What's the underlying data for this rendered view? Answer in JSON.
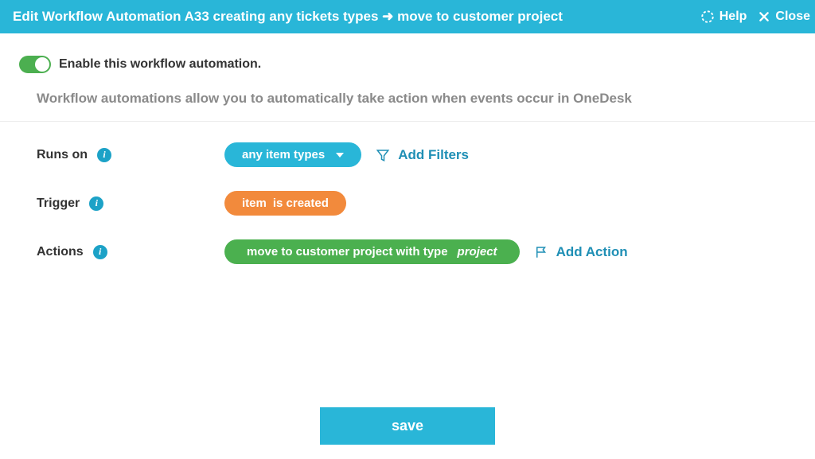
{
  "header": {
    "title": "Edit Workflow Automation A33 creating any tickets types ➜ move to customer project",
    "help": "Help",
    "close": "Close"
  },
  "enable": {
    "label": "Enable this workflow automation."
  },
  "description": "Workflow automations allow you to automatically take action when events occur in OneDesk",
  "labels": {
    "runs_on": "Runs on",
    "trigger": "Trigger",
    "actions": "Actions"
  },
  "runs_on": {
    "value": "any item types",
    "add_filters": "Add Filters"
  },
  "trigger": {
    "item": "item",
    "rest": " is created"
  },
  "actions": {
    "text": "move to customer project with type",
    "type": "project",
    "add_action": "Add Action"
  },
  "buttons": {
    "save": "save"
  }
}
